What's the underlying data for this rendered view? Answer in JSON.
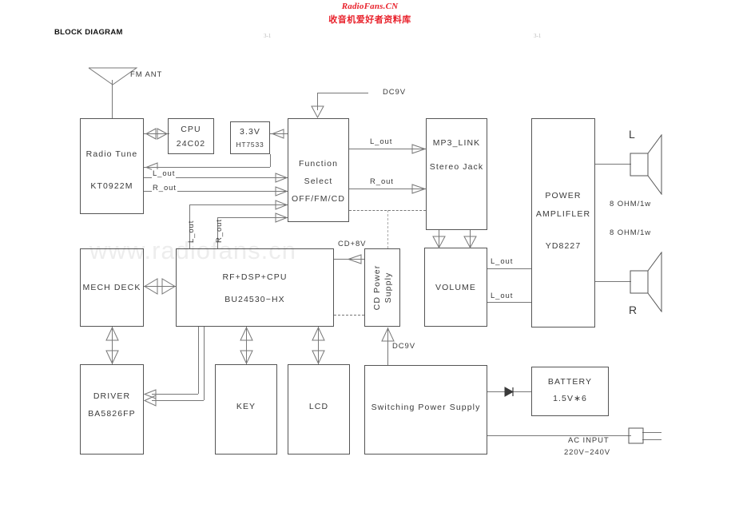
{
  "header": {
    "brand_en": "RadioFans.CN",
    "brand_cn": "收音机爱好者资料库",
    "title": "BLOCK DIAGRAM",
    "page_mark_left": "3-1",
    "page_mark_right": "3-1"
  },
  "watermark": "www.radiofans.cn",
  "blocks": {
    "radio_tune": {
      "line1": "Radio  Tune",
      "line2": "KT0922M"
    },
    "cpu": {
      "line1": "CPU",
      "line2": "24C02"
    },
    "reg": {
      "line1": "3.3V",
      "line2": "HT7533"
    },
    "function_select": {
      "line1": "Function",
      "line2": "Select",
      "line3": "OFF/FM/CD"
    },
    "mp3_link": {
      "line1": "MP3_LINK",
      "line2": "Stereo  Jack"
    },
    "power_amp": {
      "line1": "POWER",
      "line2": "AMPLIFLER",
      "line3": "YD8227"
    },
    "mech_deck": {
      "line1": "MECH  DECK"
    },
    "dsp": {
      "line1": "RF+DSP+CPU",
      "line2": "BU24530−HX"
    },
    "cd_power": {
      "line1": "CD Power",
      "line2": "Supply"
    },
    "volume": {
      "line1": "VOLUME"
    },
    "driver": {
      "line1": "DRIVER",
      "line2": "BA5826FP"
    },
    "key": {
      "line1": "KEY"
    },
    "lcd": {
      "line1": "LCD"
    },
    "switching_psu": {
      "line1": "Switching  Power  Supply"
    },
    "battery": {
      "line1": "BATTERY",
      "line2": "1.5V∗6"
    }
  },
  "labels": {
    "fm_ant": "FM  ANT",
    "dc9v_top": "DC9V",
    "dc9v_bottom": "DC9V",
    "cd_8v": "CD+8V",
    "l_out_tuner": "L_out",
    "r_out_tuner": "R_out",
    "l_out_vert": "L_out",
    "r_out_vert": "R_out",
    "l_out_fn": "L_out",
    "r_out_fn": "R_out",
    "l_out_vol_1": "L_out",
    "l_out_vol_2": "L_out",
    "speaker_l": "L",
    "speaker_r": "R",
    "ohm_l": "8  OHM/1w",
    "ohm_r": "8  OHM/1w",
    "ac_input": "AC  INPUT",
    "ac_voltage": "220V−240V"
  },
  "colors": {
    "brand_red": "#e8202a",
    "line": "#777777",
    "text": "#3a3a3a",
    "watermark": "#ededed"
  }
}
